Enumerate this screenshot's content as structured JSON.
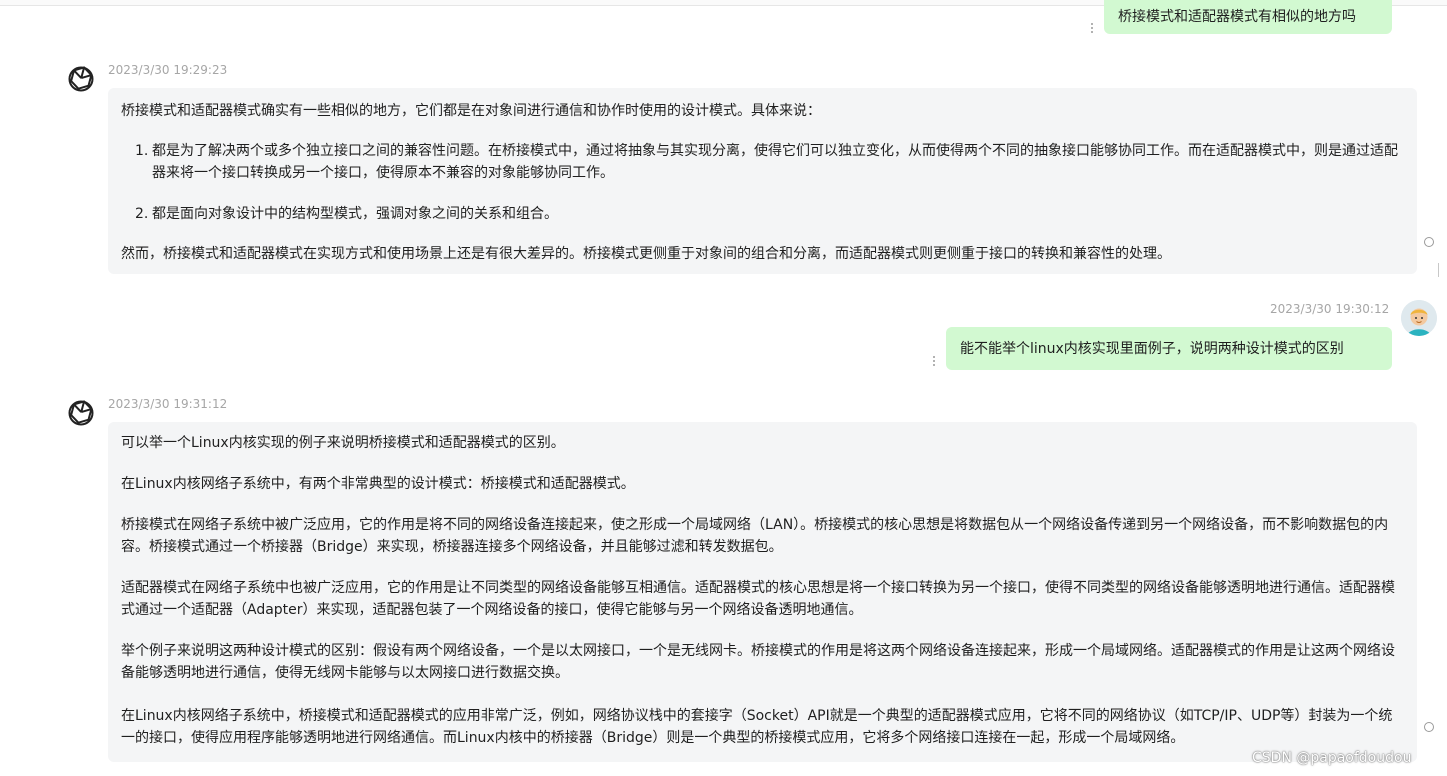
{
  "messages": {
    "user_1": {
      "text": "桥接模式和适配器模式有相似的地方吗"
    },
    "ai_1": {
      "timestamp": "2023/3/30 19:29:23",
      "intro": "桥接模式和适配器模式确实有一些相似的地方，它们都是在对象间进行通信和协作时使用的设计模式。具体来说：",
      "list": [
        {
          "num": "1.",
          "text": "都是为了解决两个或多个独立接口之间的兼容性问题。在桥接模式中，通过将抽象与其实现分离，使得它们可以独立变化，从而使得两个不同的抽象接口能够协同工作。而在适配器模式中，则是通过适配器来将一个接口转换成另一个接口，使得原本不兼容的对象能够协同工作。"
        },
        {
          "num": "2.",
          "text": "都是面向对象设计中的结构型模式，强调对象之间的关系和组合。"
        }
      ],
      "outro": "然而，桥接模式和适配器模式在实现方式和使用场景上还是有很大差异的。桥接模式更侧重于对象间的组合和分离，而适配器模式则更侧重于接口的转换和兼容性的处理。"
    },
    "user_2": {
      "timestamp": "2023/3/30 19:30:12",
      "text": "能不能举个linux内核实现里面例子，说明两种设计模式的区别"
    },
    "ai_2": {
      "timestamp": "2023/3/30 19:31:12",
      "paragraphs": [
        "可以举一个Linux内核实现的例子来说明桥接模式和适配器模式的区别。",
        "在Linux内核网络子系统中，有两个非常典型的设计模式：桥接模式和适配器模式。",
        "桥接模式在网络子系统中被广泛应用，它的作用是将不同的网络设备连接起来，使之形成一个局域网络（LAN）。桥接模式的核心思想是将数据包从一个网络设备传递到另一个网络设备，而不影响数据包的内容。桥接模式通过一个桥接器（Bridge）来实现，桥接器连接多个网络设备，并且能够过滤和转发数据包。",
        "适配器模式在网络子系统中也被广泛应用，它的作用是让不同类型的网络设备能够互相通信。适配器模式的核心思想是将一个接口转换为另一个接口，使得不同类型的网络设备能够透明地进行通信。适配器模式通过一个适配器（Adapter）来实现，适配器包装了一个网络设备的接口，使得它能够与另一个网络设备透明地通信。",
        "举个例子来说明这两种设计模式的区别：假设有两个网络设备，一个是以太网接口，一个是无线网卡。桥接模式的作用是将这两个网络设备连接起来，形成一个局域网络。适配器模式的作用是让这两个网络设备能够透明地进行通信，使得无线网卡能够与以太网接口进行数据交换。",
        "在Linux内核网络子系统中，桥接模式和适配器模式的应用非常广泛，例如，网络协议栈中的套接字（Socket）API就是一个典型的适配器模式应用，它将不同的网络协议（如TCP/IP、UDP等）封装为一个统一的接口，使得应用程序能够透明地进行网络通信。而Linux内核中的桥接器（Bridge）则是一个典型的桥接模式应用，它将多个网络接口连接在一起，形成一个局域网络。"
      ]
    }
  },
  "watermark": "CSDN @papaofdoudou",
  "icons": {
    "assistant_avatar": "openai-logo-icon",
    "user_avatar": "user-avatar-icon",
    "message_menu": "vertical-dots-icon",
    "scroll_marker": "circle-icon"
  },
  "colors": {
    "user_bubble": "#d2f9d1",
    "ai_card": "#f4f5f6",
    "timestamp": "#a6a6a6"
  }
}
